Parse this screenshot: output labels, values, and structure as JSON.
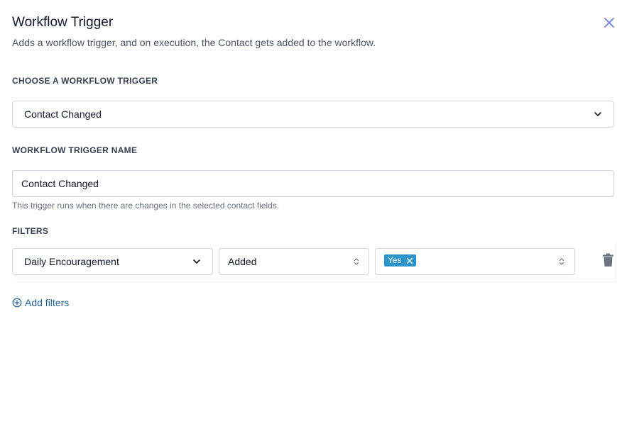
{
  "header": {
    "title": "Workflow Trigger",
    "subtitle": "Adds a workflow trigger, and on execution, the Contact gets added to the workflow.",
    "close_icon": "close-icon"
  },
  "trigger_select": {
    "label": "CHOOSE A WORKFLOW TRIGGER",
    "value": "Contact Changed",
    "icon": "chevron-down-icon"
  },
  "trigger_name": {
    "label": "WORKFLOW TRIGGER NAME",
    "value": "Contact Changed",
    "help": "This trigger runs when there are changes in the selected contact fields."
  },
  "filters": {
    "label": "FILTERS",
    "rows": [
      {
        "field": "Daily Encouragement",
        "operator": "Added",
        "tags": [
          "Yes"
        ]
      }
    ],
    "add_label": "Add filters"
  },
  "colors": {
    "accent": "#1f5f8b",
    "tag_bg": "#2b95c9",
    "close_icon": "#7b8ee8",
    "border": "#d1d5db"
  }
}
